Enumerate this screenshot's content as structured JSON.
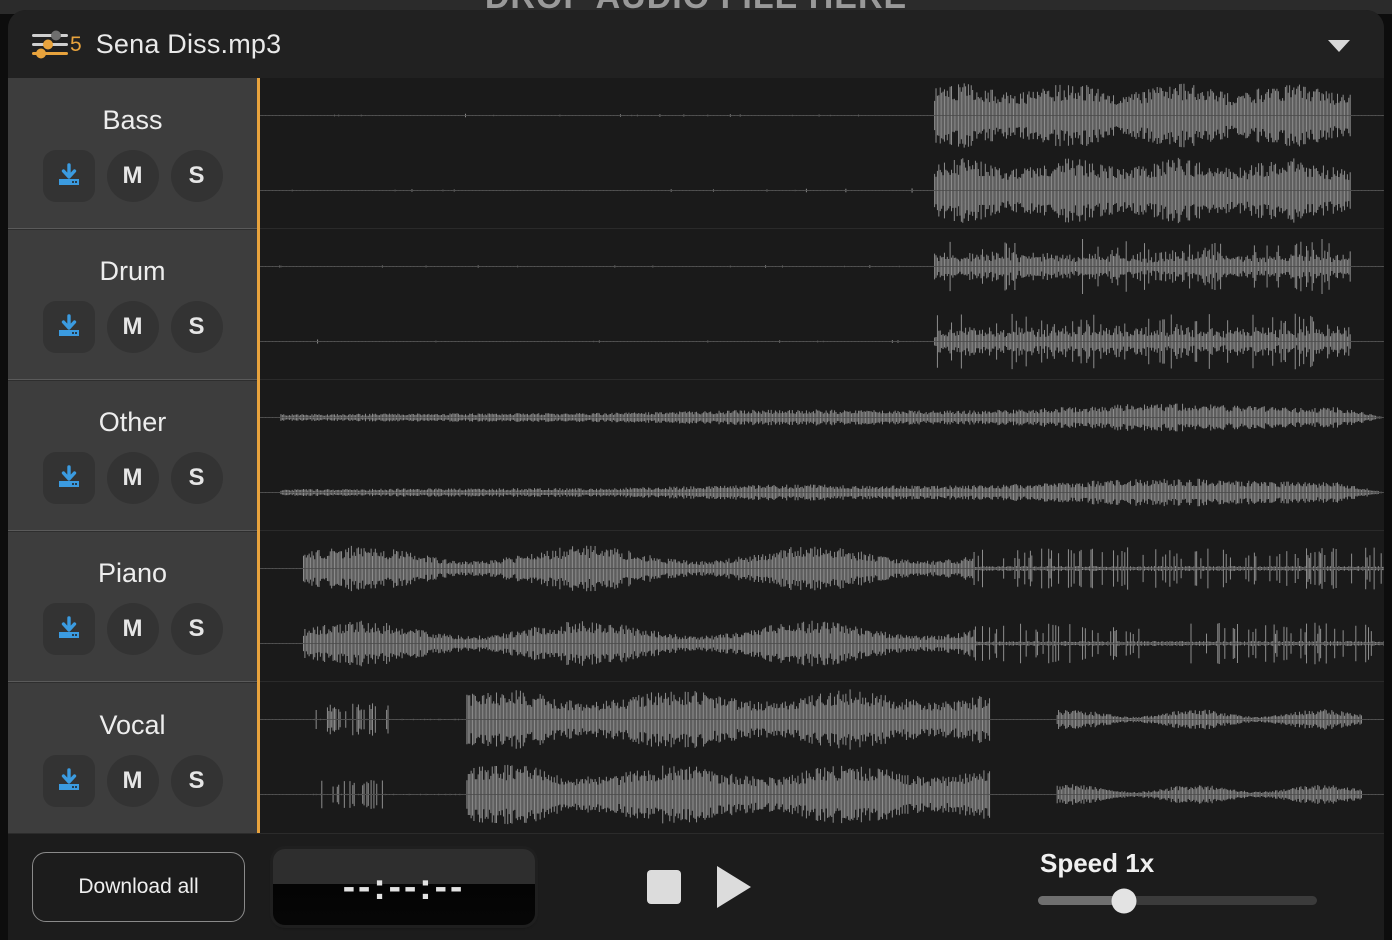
{
  "dropzone": {
    "text": "DROP AUDIO FILE HERE"
  },
  "header": {
    "icon": "mixer-sliders-icon",
    "stem_count": "5",
    "file_name": "Sena Diss.mp3",
    "dropdown_icon": "chevron-down-icon"
  },
  "stems": [
    {
      "label": "Bass",
      "download_icon": "download-icon",
      "mute_label": "M",
      "solo_label": "S"
    },
    {
      "label": "Drum",
      "download_icon": "download-icon",
      "mute_label": "M",
      "solo_label": "S"
    },
    {
      "label": "Other",
      "download_icon": "download-icon",
      "mute_label": "M",
      "solo_label": "S"
    },
    {
      "label": "Piano",
      "download_icon": "download-icon",
      "mute_label": "M",
      "solo_label": "S"
    },
    {
      "label": "Vocal",
      "download_icon": "download-icon",
      "mute_label": "M",
      "solo_label": "S"
    }
  ],
  "footer": {
    "download_all_label": "Download all",
    "time_display": "--:--:--",
    "stop_icon": "stop-icon",
    "play_icon": "play-icon",
    "speed_label": "Speed 1x",
    "speed_value": 1,
    "speed_percent": 31
  },
  "colors": {
    "accent_orange": "#e8a33d",
    "download_blue": "#3b9be0",
    "waveform_gray": "#8c8c8c",
    "window_bg": "#1c1c1c",
    "sidebar_bg": "#3d3d3d",
    "wave_bg": "#1a1a1a"
  },
  "waveforms": {
    "note": "Each stem shows two stereo channels (left/right) of mono-gray amplitude envelopes.",
    "stems": [
      {
        "name": "Bass",
        "silent_until_pct": 60,
        "peak_amp": 0.92,
        "pattern": "dense-block"
      },
      {
        "name": "Drum",
        "silent_until_pct": 60,
        "peak_amp": 0.8,
        "pattern": "spiky-transients"
      },
      {
        "name": "Other",
        "silent_until_pct": 2,
        "peak_amp": 0.55,
        "pattern": "swelling-pad"
      },
      {
        "name": "Piano",
        "silent_until_pct": 4,
        "peak_amp": 0.7,
        "pattern": "continuous-then-stabs"
      },
      {
        "name": "Vocal",
        "silent_until_pct": 3,
        "peak_amp": 0.85,
        "pattern": "phrases-with-gap"
      }
    ]
  }
}
